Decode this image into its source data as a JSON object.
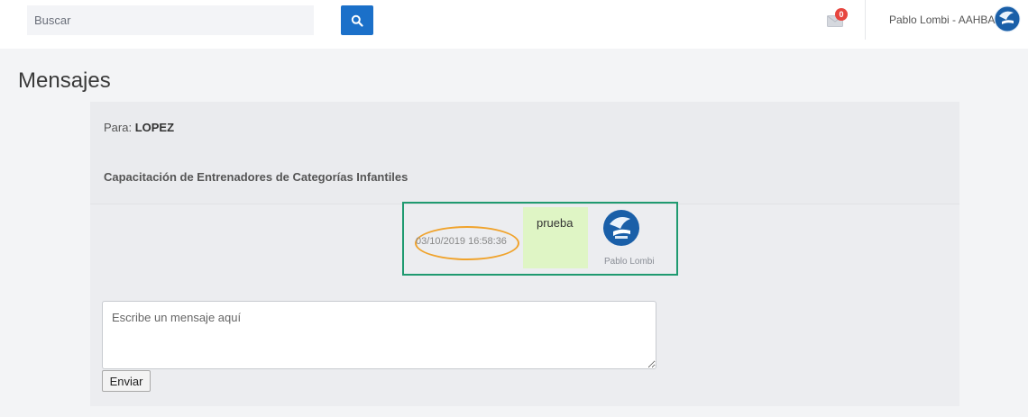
{
  "header": {
    "search": {
      "placeholder": "Buscar",
      "value": ""
    },
    "search_icon": "search-icon",
    "mail_icon": "envelope-icon",
    "mail_badge": "0",
    "user_name": "Pablo Lombi - AAHBA",
    "brand_color": "#1b70c9",
    "badge_color": "#e7463f"
  },
  "page": {
    "title": "Mensajes"
  },
  "conversation": {
    "to_label": "Para:",
    "to_value": "LOPEZ",
    "subject": "Capacitación de Entrenadores de Categorías Infantiles",
    "messages": [
      {
        "timestamp": "03/10/2019 16:58:36",
        "text": "prueba",
        "sender": "Pablo Lombi"
      }
    ],
    "highlight_box_color": "#1f9a70",
    "highlight_ring_color": "#f0a32c",
    "bubble_color": "#dff5c5"
  },
  "composer": {
    "placeholder": "Escribe un mensaje aquí",
    "value": "",
    "send_label": "Enviar"
  }
}
